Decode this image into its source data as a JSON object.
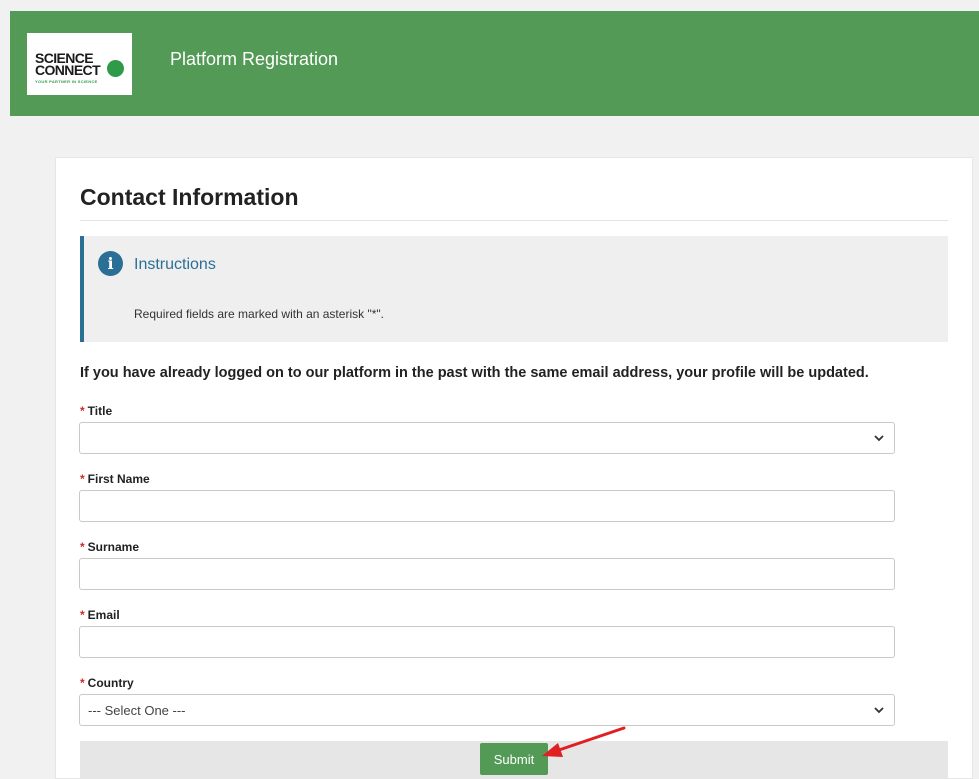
{
  "header": {
    "logo": {
      "line1": "SCIENCE",
      "line2": "CONNECT",
      "tagline": "YOUR PARTNER IN SCIENCE"
    },
    "title": "Platform Registration"
  },
  "form": {
    "section_title": "Contact Information",
    "instructions": {
      "icon": "info-icon",
      "title": "Instructions",
      "text": "Required fields are marked with an asterisk \"*\"."
    },
    "notice": "If you have already logged on to our platform in the past with the same email address, your profile will be updated.",
    "required_marker": "*",
    "fields": {
      "title": {
        "label": "Title",
        "value": ""
      },
      "first_name": {
        "label": "First Name",
        "value": ""
      },
      "surname": {
        "label": "Surname",
        "value": ""
      },
      "email": {
        "label": "Email",
        "value": ""
      },
      "country": {
        "label": "Country",
        "value": "--- Select One ---"
      }
    },
    "submit_label": "Submit"
  },
  "colors": {
    "brand_green": "#529a56",
    "info_blue": "#2c6f96",
    "required_red": "#d12b2b",
    "arrow_red": "#e02020"
  }
}
